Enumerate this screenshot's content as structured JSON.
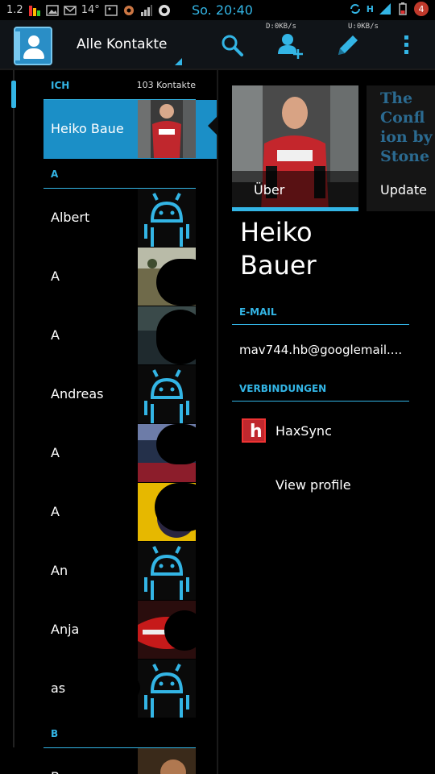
{
  "status_bar": {
    "left_value": "1.2",
    "weather_temp": "14°",
    "time": "So. 20:40",
    "download_speed": "D:0KB/s",
    "upload_speed": "U:0KB/s",
    "network_type": "H",
    "notification_count": "4"
  },
  "action_bar": {
    "title": "Alle Kontakte",
    "icons": [
      "search-icon",
      "add-contact-icon",
      "edit-icon",
      "overflow-menu-icon"
    ]
  },
  "list": {
    "me_header": "ICH",
    "contact_count": "103 Kontakte",
    "selected_name": "Heiko Bauer",
    "section_a": "A",
    "section_b": "B",
    "contacts": [
      "Albert",
      "A",
      "A",
      "Andreas",
      "A",
      "A",
      "And",
      "Anja",
      "as",
      "B"
    ]
  },
  "detail": {
    "about_label": "Über",
    "updates_label": "Update",
    "update_snippet": "The Confl ion by Stone",
    "name_line1": "Heiko",
    "name_line2": "Bauer",
    "email_header": "E-MAIL",
    "email": "mav744.hb@googlemail....",
    "connections_header": "VERBINDUNGEN",
    "connection_name": "HaxSync",
    "view_profile": "View profile"
  },
  "colors": {
    "accent": "#33b5e5",
    "selected_row": "#1b8fc7",
    "background": "#000000"
  }
}
